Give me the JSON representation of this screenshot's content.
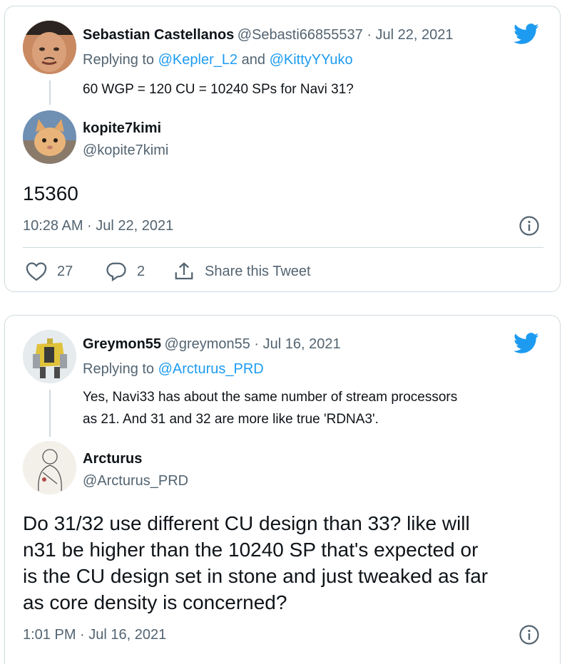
{
  "tweet1": {
    "quoted": {
      "name": "Sebastian Castellanos",
      "handle_date": "@Sebasti66855537 · Jul 22, 2021",
      "replying_prefix": "Replying to ",
      "replying_to1": "@Kepler_L2",
      "replying_and": " and ",
      "replying_to2": "@KittyYYuko",
      "text": "60 WGP = 120 CU = 10240 SPs for Navi 31?"
    },
    "author": {
      "name": "kopite7kimi",
      "handle": "@kopite7kimi"
    },
    "text": "15360",
    "timestamp": "10:28 AM · Jul 22, 2021",
    "likes": "27",
    "replies": "2",
    "share_label": "Share this Tweet"
  },
  "tweet2": {
    "quoted": {
      "name": "Greymon55",
      "handle_date": "@greymon55 · Jul 16, 2021",
      "replying_prefix": "Replying to ",
      "replying_to1": "@Arcturus_PRD",
      "text_line1": "Yes, Navi33 has about the same number of stream processors",
      "text_line2": "as 21. And 31 and 32 are more like true 'RDNA3'."
    },
    "author": {
      "name": "Arcturus",
      "handle": "@Arcturus_PRD"
    },
    "text_lines": [
      "Do 31/32 use different CU design than 33? like will",
      "n31 be higher than the 10240 SP that's expected or",
      "is the CU design set in stone and just tweaked as far",
      "as core density is concerned?"
    ],
    "timestamp": "1:01 PM · Jul 16, 2021"
  },
  "colors": {
    "twitter_blue": "#1d9bf0",
    "secondary_text": "#536471",
    "border": "#cfd9de"
  },
  "icons": [
    "twitter-bird-icon",
    "info-icon",
    "heart-icon",
    "reply-bubble-icon",
    "share-icon"
  ]
}
